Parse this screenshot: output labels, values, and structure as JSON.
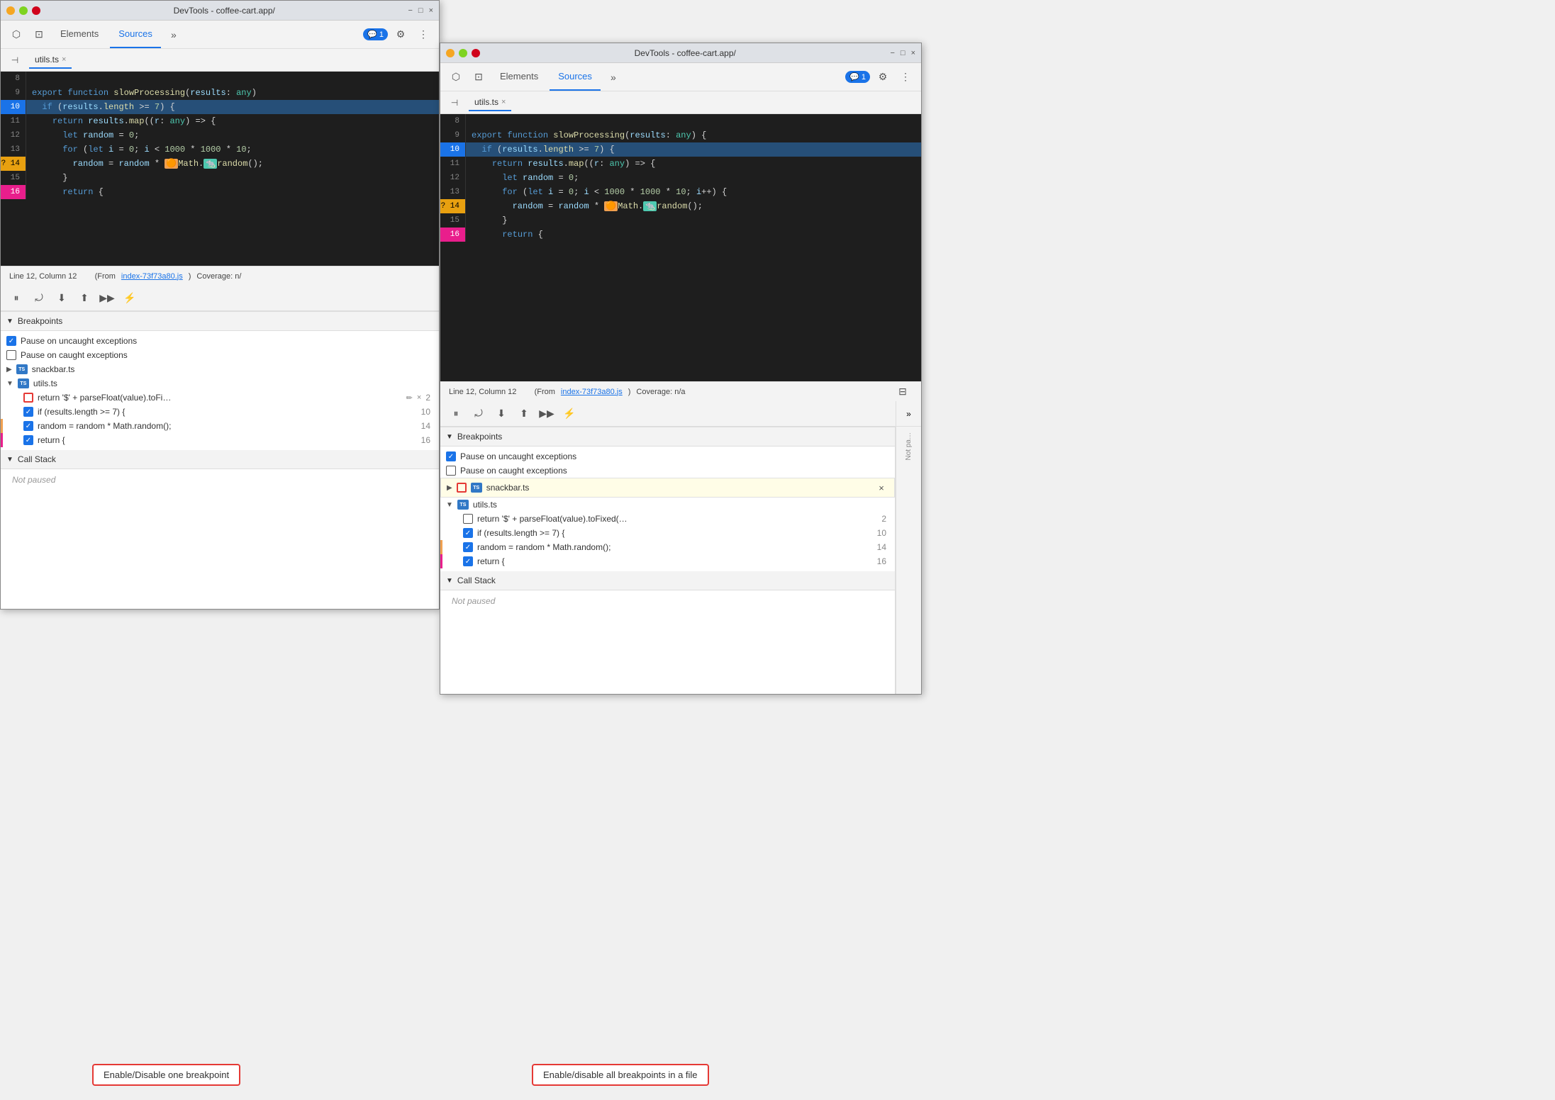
{
  "window1": {
    "title": "DevTools - coffee-cart.app/",
    "toolbar": {
      "tabs": [
        "Elements",
        "Sources"
      ],
      "active_tab": "Sources",
      "more_btn": "»",
      "badge": "1",
      "badge_icon": "💬",
      "settings_icon": "⚙",
      "more_dots": "⋮"
    },
    "file_tab": {
      "name": "utils.ts",
      "close": "×"
    },
    "code": {
      "lines": [
        {
          "num": "8",
          "content": ""
        },
        {
          "num": "9",
          "content": "export function slowProcessing(results: any)"
        },
        {
          "num": "10",
          "content": "  if (results.length >= 7) {",
          "type": "paused"
        },
        {
          "num": "11",
          "content": "    return results.map((r: any) => {"
        },
        {
          "num": "12",
          "content": "      let random = 0;"
        },
        {
          "num": "13",
          "content": "      for (let i = 0; i < 1000 * 1000 * 10;"
        },
        {
          "num": "14",
          "content": "        random = random * 🟠Math.🐠random();",
          "type": "question"
        },
        {
          "num": "15",
          "content": "      }"
        },
        {
          "num": "16",
          "content": "      return {",
          "type": "pink"
        }
      ]
    },
    "statusbar": {
      "position": "Line 12, Column 12",
      "from_label": "(From",
      "from_file": "index-73f73a80.js",
      "coverage": "Coverage: n/"
    },
    "debug_toolbar": {
      "pause_icon": "⏸",
      "step_over": "↷",
      "step_into": "↓",
      "step_out": "↑",
      "continue": "→→",
      "deactivate": "⛔"
    },
    "breakpoints": {
      "section_label": "Breakpoints",
      "pause_uncaught": "Pause on uncaught exceptions",
      "pause_uncaught_checked": true,
      "pause_caught": "Pause on caught exceptions",
      "pause_caught_checked": false,
      "files": [
        {
          "name": "snackbar.ts",
          "icon": "ts",
          "expanded": false
        },
        {
          "name": "utils.ts",
          "icon": "ts",
          "expanded": true,
          "breakpoints": [
            {
              "label": "return '$' + parseFloat(value).toFi…",
              "line": "2",
              "checked": false,
              "red_border": true
            },
            {
              "label": "if (results.length >= 7) {",
              "line": "10",
              "checked": true
            },
            {
              "label": "random = random * Math.random();",
              "line": "14",
              "checked": true
            },
            {
              "label": "return {",
              "line": "16",
              "checked": true
            }
          ]
        }
      ]
    },
    "callstack": {
      "label": "Call Stack",
      "not_paused": "Not paused"
    }
  },
  "window2": {
    "title": "DevTools - coffee-cart.app/",
    "toolbar": {
      "tabs": [
        "Elements",
        "Sources"
      ],
      "active_tab": "Sources",
      "more_btn": "»",
      "badge": "1",
      "badge_icon": "💬",
      "settings_icon": "⚙",
      "more_dots": "⋮"
    },
    "file_tab": {
      "name": "utils.ts",
      "close": "×"
    },
    "code": {
      "lines": [
        {
          "num": "8",
          "content": ""
        },
        {
          "num": "9",
          "content": "export function slowProcessing(results: any) {"
        },
        {
          "num": "10",
          "content": "  if (results.length >= 7) {",
          "type": "paused"
        },
        {
          "num": "11",
          "content": "    return results.map((r: any) => {"
        },
        {
          "num": "12",
          "content": "      let random = 0;"
        },
        {
          "num": "13",
          "content": "      for (let i = 0; i < 1000 * 1000 * 10; i++) {"
        },
        {
          "num": "14",
          "content": "        random = random * 🟠Math.🐠random();",
          "type": "question"
        },
        {
          "num": "15",
          "content": "      }"
        },
        {
          "num": "16",
          "content": "      return {",
          "type": "pink"
        }
      ]
    },
    "statusbar": {
      "position": "Line 12, Column 12",
      "from_label": "(From",
      "from_file": "index-73f73a80.js",
      "coverage": "Coverage: n/a",
      "icon": "📋"
    },
    "debug_toolbar": {
      "pause_icon": "⏸",
      "step_over": "↷",
      "step_into": "↓",
      "step_out": "↑",
      "continue": "→→",
      "deactivate": "⛔",
      "more": "»"
    },
    "breakpoints": {
      "section_label": "Breakpoints",
      "pause_uncaught": "Pause on uncaught exceptions",
      "pause_uncaught_checked": true,
      "pause_caught": "Pause on caught exceptions",
      "pause_caught_checked": false,
      "files": [
        {
          "name": "snackbar.ts",
          "icon": "ts",
          "expanded": false,
          "highlighted": true
        },
        {
          "name": "utils.ts",
          "icon": "ts",
          "expanded": true,
          "breakpoints": [
            {
              "label": "return '$' + parseFloat(value).toFixed(…",
              "line": "2",
              "checked": false
            },
            {
              "label": "if (results.length >= 7) {",
              "line": "10",
              "checked": true
            },
            {
              "label": "random = random * Math.random();",
              "line": "14",
              "checked": true
            },
            {
              "label": "return {",
              "line": "16",
              "checked": true
            }
          ]
        }
      ]
    },
    "callstack": {
      "label": "Call Stack",
      "not_paused": "Not paused"
    },
    "not_paused_right": "Not pa…"
  },
  "tooltips": {
    "left": "Enable/Disable one breakpoint",
    "right": "Enable/disable all breakpoints in a file"
  },
  "icons": {
    "chevron_down": "▼",
    "chevron_right": "▶",
    "inspect": "⬡",
    "device": "□",
    "pause": "⏸",
    "step_over": "⤾",
    "step_into": "⬇",
    "step_out": "⬆",
    "resume": "▶▶",
    "deactivate": "✕",
    "settings": "⚙",
    "more_vert": "⋮"
  }
}
